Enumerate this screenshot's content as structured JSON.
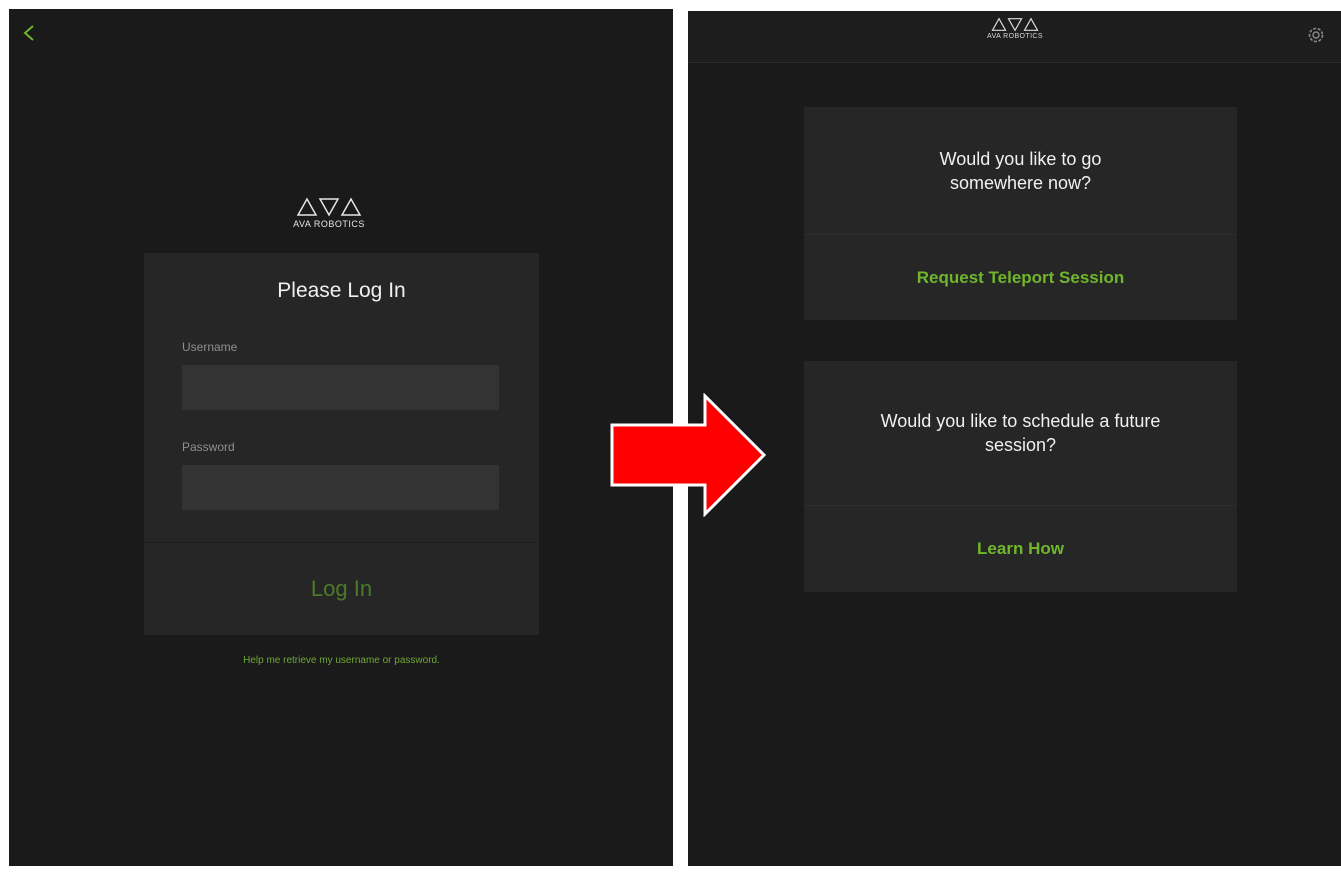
{
  "colors": {
    "background": "#1a1a1a",
    "card": "#262626",
    "input": "#333333",
    "accent_green": "#6fb62c",
    "dim_green": "#4d7a2a",
    "arrow_red": "#ff0000"
  },
  "left_screen": {
    "back_icon": "chevron-left-icon",
    "logo_text": "AVA ROBOTICS",
    "login": {
      "title": "Please Log In",
      "username_label": "Username",
      "username_value": "",
      "password_label": "Password",
      "password_value": "",
      "login_button": "Log In"
    },
    "help_link": "Help me retrieve my username or password."
  },
  "right_screen": {
    "logo_text": "AVA ROBOTICS",
    "settings_icon": "gear-icon",
    "cards": [
      {
        "question": "Would you like to go somewhere now?",
        "action": "Request Teleport Session"
      },
      {
        "question": "Would you like to schedule a future session?",
        "action": "Learn How"
      }
    ]
  },
  "transition_arrow": "arrow-right-icon"
}
